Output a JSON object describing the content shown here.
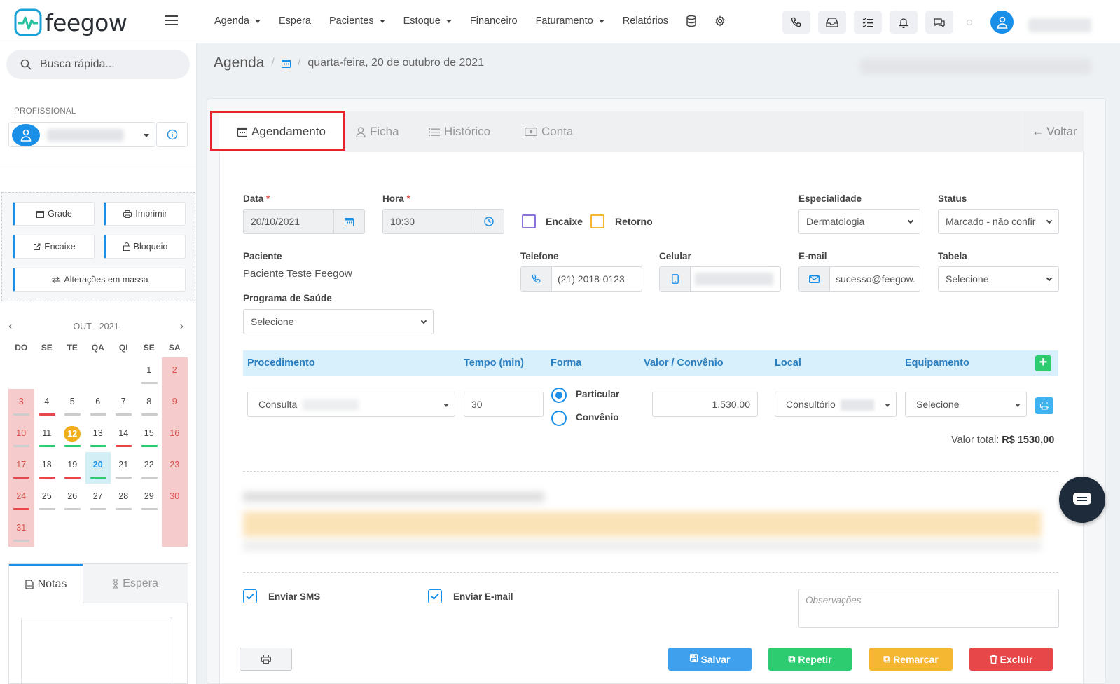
{
  "app": {
    "logo_text": "feegow"
  },
  "nav": {
    "items": [
      {
        "label": "Agenda",
        "dropdown": true
      },
      {
        "label": "Espera",
        "dropdown": false
      },
      {
        "label": "Pacientes",
        "dropdown": true
      },
      {
        "label": "Estoque",
        "dropdown": true
      },
      {
        "label": "Financeiro",
        "dropdown": false
      },
      {
        "label": "Faturamento",
        "dropdown": true
      },
      {
        "label": "Relatórios",
        "dropdown": false
      }
    ]
  },
  "sidebar": {
    "search_placeholder": "Busca rápida...",
    "profissional_label": "PROFISSIONAL",
    "buttons": {
      "grade": "Grade",
      "imprimir": "Imprimir",
      "encaixe": "Encaixe",
      "bloqueio": "Bloqueio",
      "alteracoes": "Alterações em massa"
    },
    "calendar": {
      "month_label": "OUT - 2021",
      "weekdays": [
        "DO",
        "SE",
        "TE",
        "QA",
        "QI",
        "SE",
        "SA"
      ],
      "weeks": [
        [
          "",
          "",
          "",
          "",
          "",
          "1",
          "2"
        ],
        [
          "3",
          "4",
          "5",
          "6",
          "7",
          "8",
          "9"
        ],
        [
          "10",
          "11",
          "12",
          "13",
          "14",
          "15",
          "16"
        ],
        [
          "17",
          "18",
          "19",
          "20",
          "21",
          "22",
          "23"
        ],
        [
          "24",
          "25",
          "26",
          "27",
          "28",
          "29",
          "30"
        ],
        [
          "31",
          "",
          "",
          "",
          "",
          "",
          ""
        ]
      ],
      "today": "12",
      "selected": "20"
    },
    "tabs": {
      "notas": "Notas",
      "espera": "Espera"
    }
  },
  "breadcrumb": {
    "title": "Agenda",
    "separator": "/",
    "date": "quarta-feira, 20 de outubro de 2021"
  },
  "tabs": {
    "agendamento": "Agendamento",
    "ficha": "Ficha",
    "historico": "Histórico",
    "conta": "Conta",
    "voltar": "Voltar"
  },
  "form": {
    "data_label": "Data",
    "data_value": "20/10/2021",
    "hora_label": "Hora",
    "hora_value": "10:30",
    "required_mark": "*",
    "encaixe_label": "Encaixe",
    "retorno_label": "Retorno",
    "especialidade_label": "Especialidade",
    "especialidade_value": "Dermatologia",
    "status_label": "Status",
    "status_value": "Marcado - não confir",
    "paciente_label": "Paciente",
    "paciente_value": "Paciente Teste Feegow",
    "telefone_label": "Telefone",
    "telefone_value": "(21) 2018-0123",
    "celular_label": "Celular",
    "email_label": "E-mail",
    "email_value": "sucesso@feegow.",
    "tabela_label": "Tabela",
    "tabela_value": "Selecione",
    "programa_label": "Programa de Saúde",
    "programa_value": "Selecione"
  },
  "procedures": {
    "headers": {
      "procedimento": "Procedimento",
      "tempo": "Tempo (min)",
      "forma": "Forma",
      "valor": "Valor / Convênio",
      "local": "Local",
      "equipamento": "Equipamento"
    },
    "row": {
      "procedimento": "Consulta",
      "tempo": "30",
      "forma_particular": "Particular",
      "forma_convenio": "Convênio",
      "valor": "1.530,00",
      "local": "Consultório",
      "equipamento": "Selecione"
    },
    "total_label": "Valor total:",
    "total_value": "R$ 1530,00"
  },
  "options": {
    "sms": "Enviar SMS",
    "email": "Enviar E-mail",
    "obs_placeholder": "Observações"
  },
  "actions": {
    "salvar": "Salvar",
    "repetir": "Repetir",
    "remarcar": "Remarcar",
    "excluir": "Excluir"
  },
  "colors": {
    "primary": "#1a8fe8",
    "success": "#2ecc71",
    "warning": "#f5b731",
    "danger": "#e8474a",
    "highlight": "#e8232b"
  }
}
